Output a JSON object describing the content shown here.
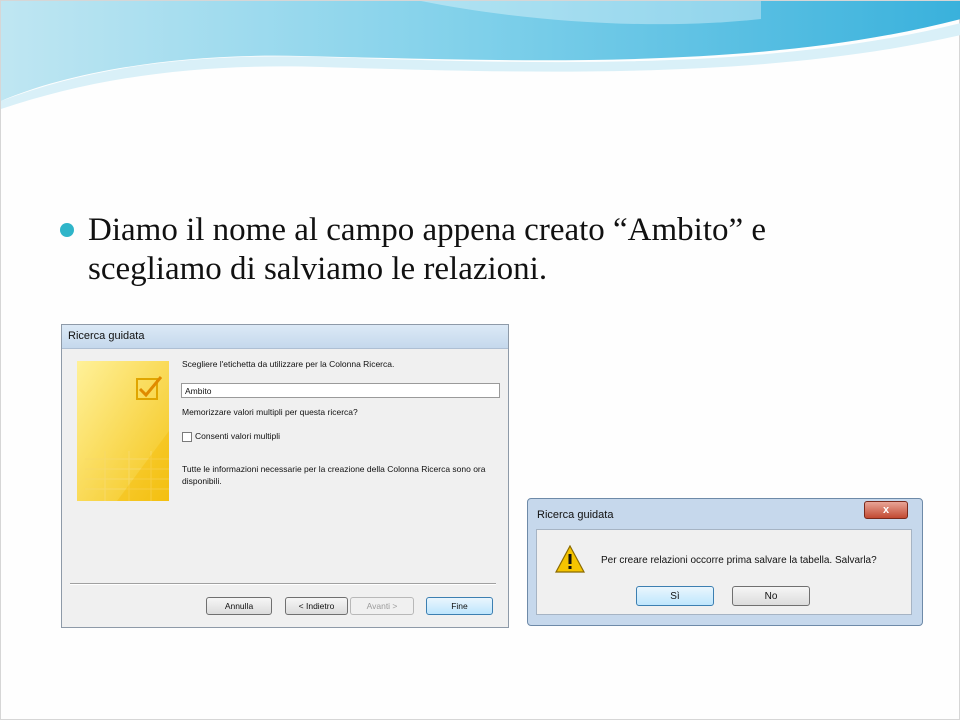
{
  "slide": {
    "bullet_text": "Diamo il nome al campo appena creato “Ambito” e scegliamo di salviamo le relazioni."
  },
  "wizard": {
    "title": "Ricerca guidata",
    "prompt": "Scegliere l'etichetta da utilizzare per la Colonna Ricerca.",
    "label_value": "Ambito",
    "multi_question": "Memorizzare valori multipli per questa ricerca?",
    "checkbox_label": "Consenti valori multipli",
    "checkbox_checked": false,
    "info": "Tutte le informazioni necessarie per la creazione della Colonna Ricerca sono ora disponibili.",
    "buttons": {
      "cancel": "Annulla",
      "back": "< Indietro",
      "next": "Avanti >",
      "finish": "Fine"
    }
  },
  "dialog": {
    "title": "Ricerca guidata",
    "close_glyph": "x",
    "message": "Per creare relazioni occorre prima salvare la tabella. Salvarla?",
    "icon": "warning-icon",
    "buttons": {
      "yes": "Sì",
      "no": "No"
    }
  },
  "colors": {
    "bullet": "#2fb5c9",
    "wave": "#5cc3e4",
    "close_button": "#c24a32"
  }
}
